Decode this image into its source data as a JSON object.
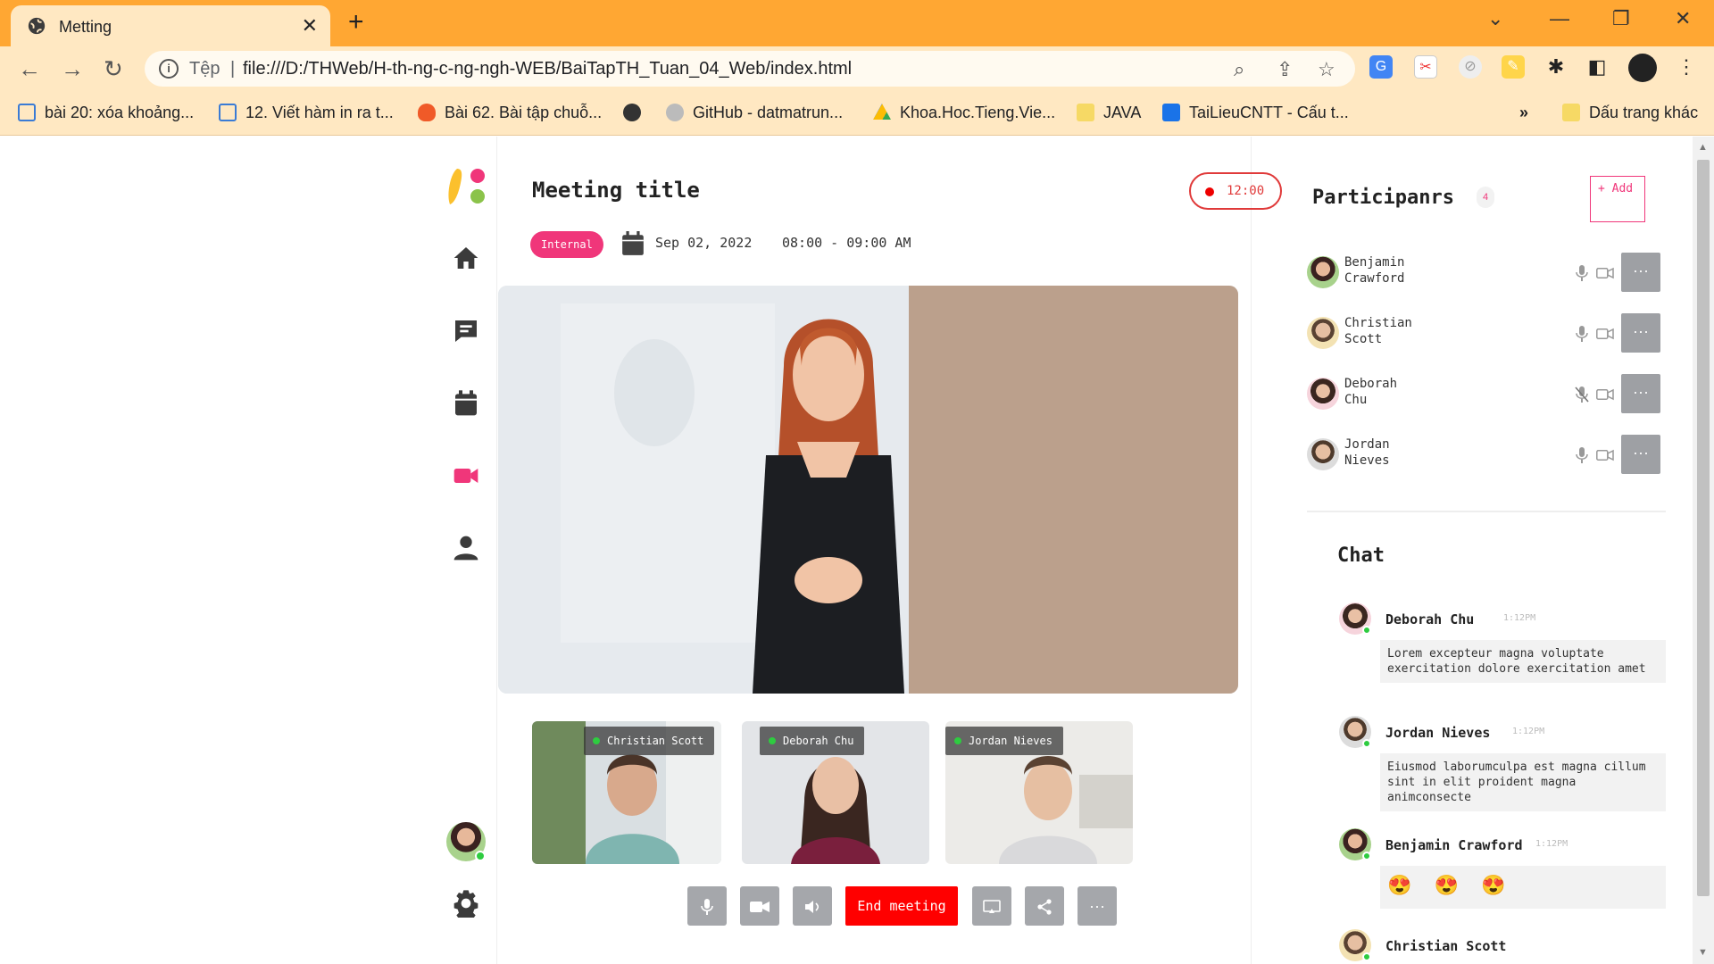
{
  "browser": {
    "tab_title": "Metting",
    "tab_icon": "globe-icon",
    "scheme_label": "Tệp",
    "separator": "|",
    "url": "file:///D:/THWeb/H-th-ng-c-ng-ngh-WEB/BaiTapTH_Tuan_04_Web/index.html",
    "bookmarks": [
      {
        "label": "bài 20: xóa khoảng...",
        "icon": "doc-icon",
        "color": "#3a7bd5"
      },
      {
        "label": "12. Viết hàm in ra t...",
        "icon": "doc-icon",
        "color": "#3a7bd5"
      },
      {
        "label": "Bài 62. Bài tập chuỗ...",
        "icon": "fire-icon",
        "color": "#f05a28"
      },
      {
        "label": "",
        "icon": "globe-icon",
        "color": "#333333"
      },
      {
        "label": "GitHub - datmatrun...",
        "icon": "github-icon",
        "color": "#333333"
      },
      {
        "label": "Khoa.Hoc.Tieng.Vie...",
        "icon": "drive-icon",
        "color": "#34a853"
      },
      {
        "label": "JAVA",
        "icon": "folder-icon",
        "color": "#f6c945"
      },
      {
        "label": "TaiLieuCNTT - Cấu t...",
        "icon": "tailieu-icon",
        "color": "#1a73e8"
      }
    ],
    "more_bookmarks": "»",
    "other_bookmarks": "Dấu trang khác"
  },
  "sidebar": {
    "items": [
      {
        "name": "home-icon",
        "active": false
      },
      {
        "name": "chat-icon",
        "active": false
      },
      {
        "name": "calendar-icon",
        "active": false
      },
      {
        "name": "video-icon",
        "active": true
      },
      {
        "name": "user-icon",
        "active": false
      }
    ],
    "accent": "#f0367a"
  },
  "meeting": {
    "title": "Meeting title",
    "timer": "12:00",
    "badge": "Internal",
    "date": "Sep 02, 2022",
    "time": "08:00 - 09:00 AM",
    "thumbnails": [
      {
        "name": "Christian Scott"
      },
      {
        "name": "Deborah Chu"
      },
      {
        "name": "Jordan Nieves"
      }
    ],
    "end_label": "End meeting"
  },
  "participants": {
    "title": "Participanrs",
    "count": "4",
    "add_label": "+ Add",
    "list": [
      {
        "first": "Benjamin",
        "last": "Crawford",
        "mic_muted": false
      },
      {
        "first": "Christian",
        "last": "Scott",
        "mic_muted": false
      },
      {
        "first": "Deborah",
        "last": "Chu",
        "mic_muted": true
      },
      {
        "first": "Jordan",
        "last": "Nieves",
        "mic_muted": false
      }
    ]
  },
  "chat": {
    "title": "Chat",
    "messages": [
      {
        "author": "Deborah Chu",
        "time": "1:12PM",
        "text": "Lorem excepteur magna voluptate exercitation dolore exercitation amet"
      },
      {
        "author": "Jordan Nieves",
        "time": "1:12PM",
        "text": "Eiusmod laborumculpa est magna cillum sint in elit proident magna animconsecte"
      },
      {
        "author": "Benjamin Crawford",
        "time": "1:12PM",
        "text": "😍 😍 😍"
      },
      {
        "author": "Christian Scott",
        "time": "",
        "text": ""
      }
    ]
  }
}
